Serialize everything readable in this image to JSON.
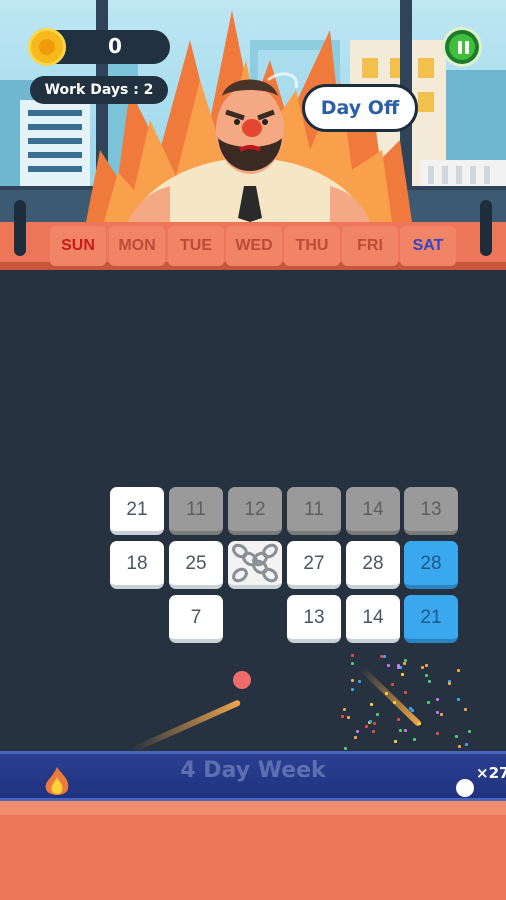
{
  "hud": {
    "coins": "0",
    "work_days": "Work Days : 2",
    "pause_icon": "pause-icon",
    "coin_icon": "coin-icon"
  },
  "boss": {
    "speech": "Day Off"
  },
  "weekdays": [
    "SUN",
    "MON",
    "TUE",
    "WED",
    "THU",
    "FRI",
    "SAT"
  ],
  "board": {
    "rows": [
      [
        {
          "value": "21",
          "type": "white"
        },
        {
          "value": "11",
          "type": "gray"
        },
        {
          "value": "12",
          "type": "gray"
        },
        {
          "value": "11",
          "type": "gray"
        },
        {
          "value": "14",
          "type": "gray"
        },
        {
          "value": "13",
          "type": "gray"
        }
      ],
      [
        {
          "value": "18",
          "type": "white"
        },
        {
          "value": "25",
          "type": "white"
        },
        {
          "value": "",
          "type": "chain"
        },
        {
          "value": "27",
          "type": "white"
        },
        {
          "value": "28",
          "type": "white"
        },
        {
          "value": "28",
          "type": "blue"
        }
      ],
      [
        {
          "value": "",
          "type": "empty"
        },
        {
          "value": "7",
          "type": "white"
        },
        {
          "value": "",
          "type": "empty"
        },
        {
          "value": "13",
          "type": "white"
        },
        {
          "value": "14",
          "type": "white"
        },
        {
          "value": "21",
          "type": "blue"
        }
      ]
    ]
  },
  "bottom": {
    "banner_text": "4 Day Week",
    "multiplier": "×27"
  },
  "colors": {
    "background": "#263240",
    "accent_orange": "#ec7657",
    "sunday": "#c81c1c",
    "saturday": "#3346c8",
    "tile_blue": "#3aa8ef",
    "tile_gray": "#9a9a9a"
  }
}
